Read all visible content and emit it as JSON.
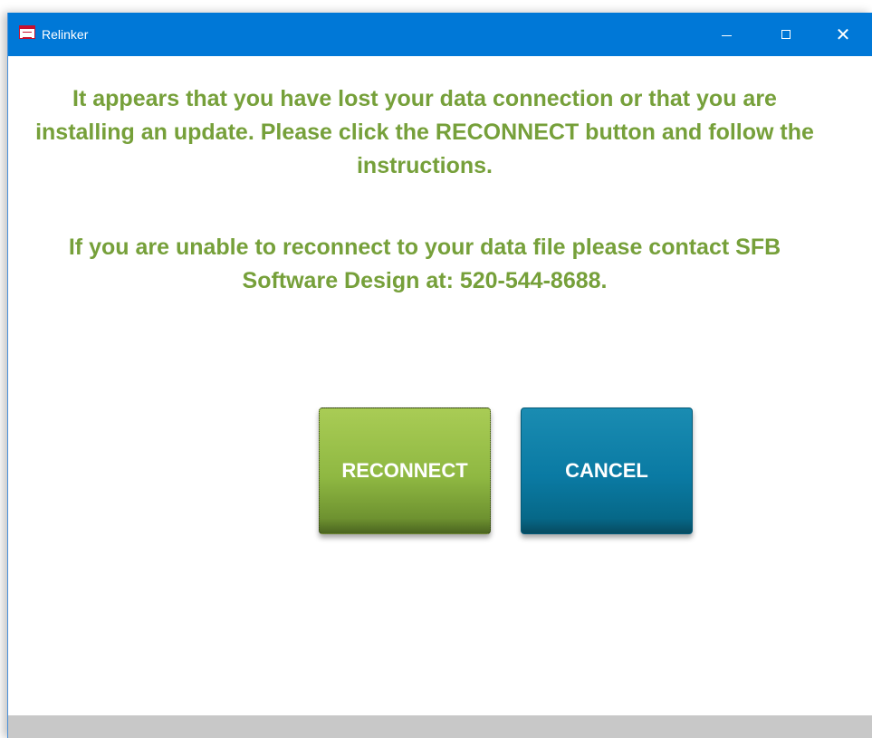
{
  "window": {
    "title": "Relinker",
    "icon": "access-form-icon"
  },
  "controls": {
    "minimize": "minimize-icon",
    "maximize": "maximize-icon",
    "close": "close-icon",
    "close_glyph": "✕"
  },
  "message": {
    "line1": "It appears that you have lost your data connection or that you are installing an update.  Please click the RECONNECT button and follow the instructions.",
    "line2": "If you are unable to reconnect to your data file please contact SFB Software Design at:  520-544-8688."
  },
  "buttons": {
    "reconnect_label": "RECONNECT",
    "cancel_label": "CANCEL"
  },
  "colors": {
    "titlebar": "#0078d7",
    "message_text": "#76a03a",
    "reconnect_button": "#8fb842",
    "cancel_button": "#0a7aa3",
    "statusbar": "#c8c8c8"
  }
}
